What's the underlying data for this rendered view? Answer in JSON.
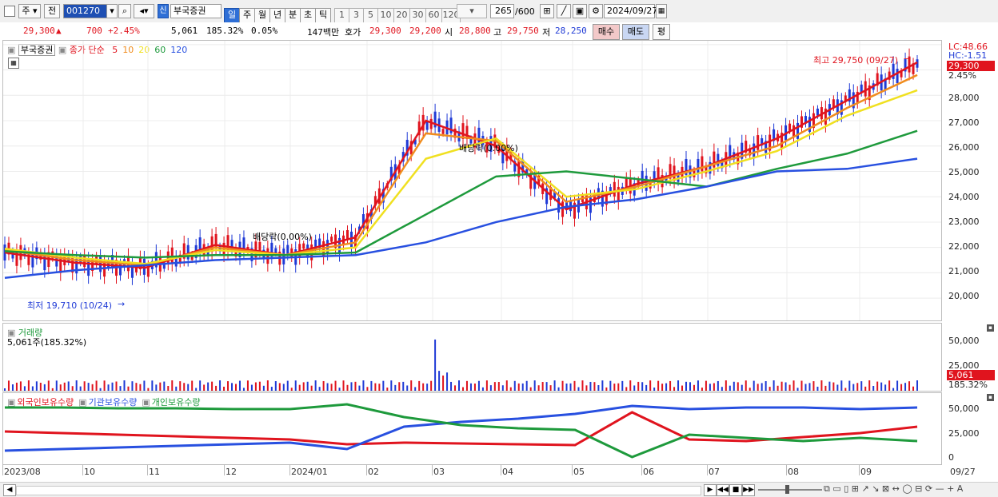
{
  "toolbar": {
    "period_type": "주",
    "prev_label": "전",
    "stock_code": "001270",
    "new_badge": "신",
    "stock_name": "부국증권",
    "periods": [
      "일",
      "주",
      "월",
      "년",
      "분",
      "초",
      "틱"
    ],
    "active_period": "일",
    "ticks": [
      "1",
      "3",
      "5",
      "10",
      "20",
      "30",
      "60",
      "120"
    ],
    "count_value": "265",
    "count_total": "/600",
    "date": "2024/09/27"
  },
  "quote": {
    "price": "29,300",
    "up_arrow": "▲",
    "change": "700",
    "change_pct": "+2.45%",
    "volume": "5,061",
    "volume_ratio": "185.32%",
    "turnover": "0.05%",
    "amount": "147백만",
    "ask_label": "호가",
    "ask": "29,300",
    "bid": "29,200",
    "open_label": "시",
    "open": "28,800",
    "high_label": "고",
    "high": "29,750",
    "low_label": "저",
    "low": "28,250",
    "buy_label": "매수",
    "sell_label": "매도",
    "eval_label": "평"
  },
  "price_pane": {
    "name": "부국증권",
    "ma_label": "종가 단순",
    "ma_periods": [
      "5",
      "10",
      "20",
      "60",
      "120"
    ],
    "ma_colors": [
      "#e0141e",
      "#f08c1e",
      "#f0e020",
      "#1e9a3c",
      "#2850e0"
    ],
    "lc": "LC:48.66",
    "hc": "HC:-1.51",
    "last_price": "29,300",
    "last_pct": "2.45%",
    "high_note": "최고 29,750 (09/27)",
    "low_note": "최저 19,710 (10/24)",
    "dividend_note_1": "배당락(0.00%)",
    "dividend_note_2": "배당락(0.00%)",
    "y_ticks": [
      "28,000",
      "27,000",
      "26,000",
      "25,000",
      "24,000",
      "23,000",
      "22,000",
      "21,000",
      "20,000"
    ]
  },
  "volume_pane": {
    "title": "거래량",
    "value": "5,061주(185.32%)",
    "y_ticks": [
      "50,000",
      "25,000"
    ],
    "last_value": "5,061",
    "last_pct": "185.32%"
  },
  "holding_pane": {
    "legends": [
      "외국인보유수량",
      "기관보유수량",
      "개인보유수량"
    ],
    "legend_colors": [
      "#e0141e",
      "#2850e0",
      "#1e9a3c"
    ],
    "y_ticks": [
      "50,000",
      "25,000",
      "0"
    ]
  },
  "x_axis": [
    "2023/08",
    "10",
    "11",
    "12",
    "2024/01",
    "02",
    "03",
    "04",
    "05",
    "06",
    "07",
    "08",
    "09",
    "09/27"
  ],
  "chart_data": {
    "type": "line",
    "x": [
      "2023/08",
      "2023/10",
      "2023/11",
      "2023/12",
      "2024/01",
      "2024/02",
      "2024/03",
      "2024/04",
      "2024/05",
      "2024/06",
      "2024/07",
      "2024/08",
      "2024/09",
      "2024/09/27"
    ],
    "series": [
      {
        "name": "5",
        "values": [
          21800,
          21400,
          21200,
          22100,
          21700,
          22400,
          27000,
          26000,
          23500,
          24500,
          25200,
          26300,
          27800,
          29300
        ]
      },
      {
        "name": "10",
        "values": [
          21900,
          21500,
          21300,
          22000,
          21700,
          22200,
          26500,
          26200,
          23800,
          24400,
          25200,
          26000,
          27500,
          28800
        ]
      },
      {
        "name": "20",
        "values": [
          21950,
          21600,
          21350,
          21900,
          21700,
          22000,
          25500,
          26300,
          24000,
          24300,
          25000,
          25800,
          27200,
          28200
        ]
      },
      {
        "name": "60",
        "values": [
          21850,
          21700,
          21600,
          21700,
          21700,
          21800,
          23300,
          24800,
          25000,
          24700,
          24400,
          25100,
          25700,
          26600
        ]
      },
      {
        "name": "120",
        "values": [
          20800,
          21100,
          21300,
          21500,
          21600,
          21700,
          22200,
          23000,
          23600,
          23900,
          24400,
          25000,
          25100,
          25500
        ]
      }
    ],
    "ylabel": "",
    "ylim": [
      19500,
      29900
    ]
  }
}
